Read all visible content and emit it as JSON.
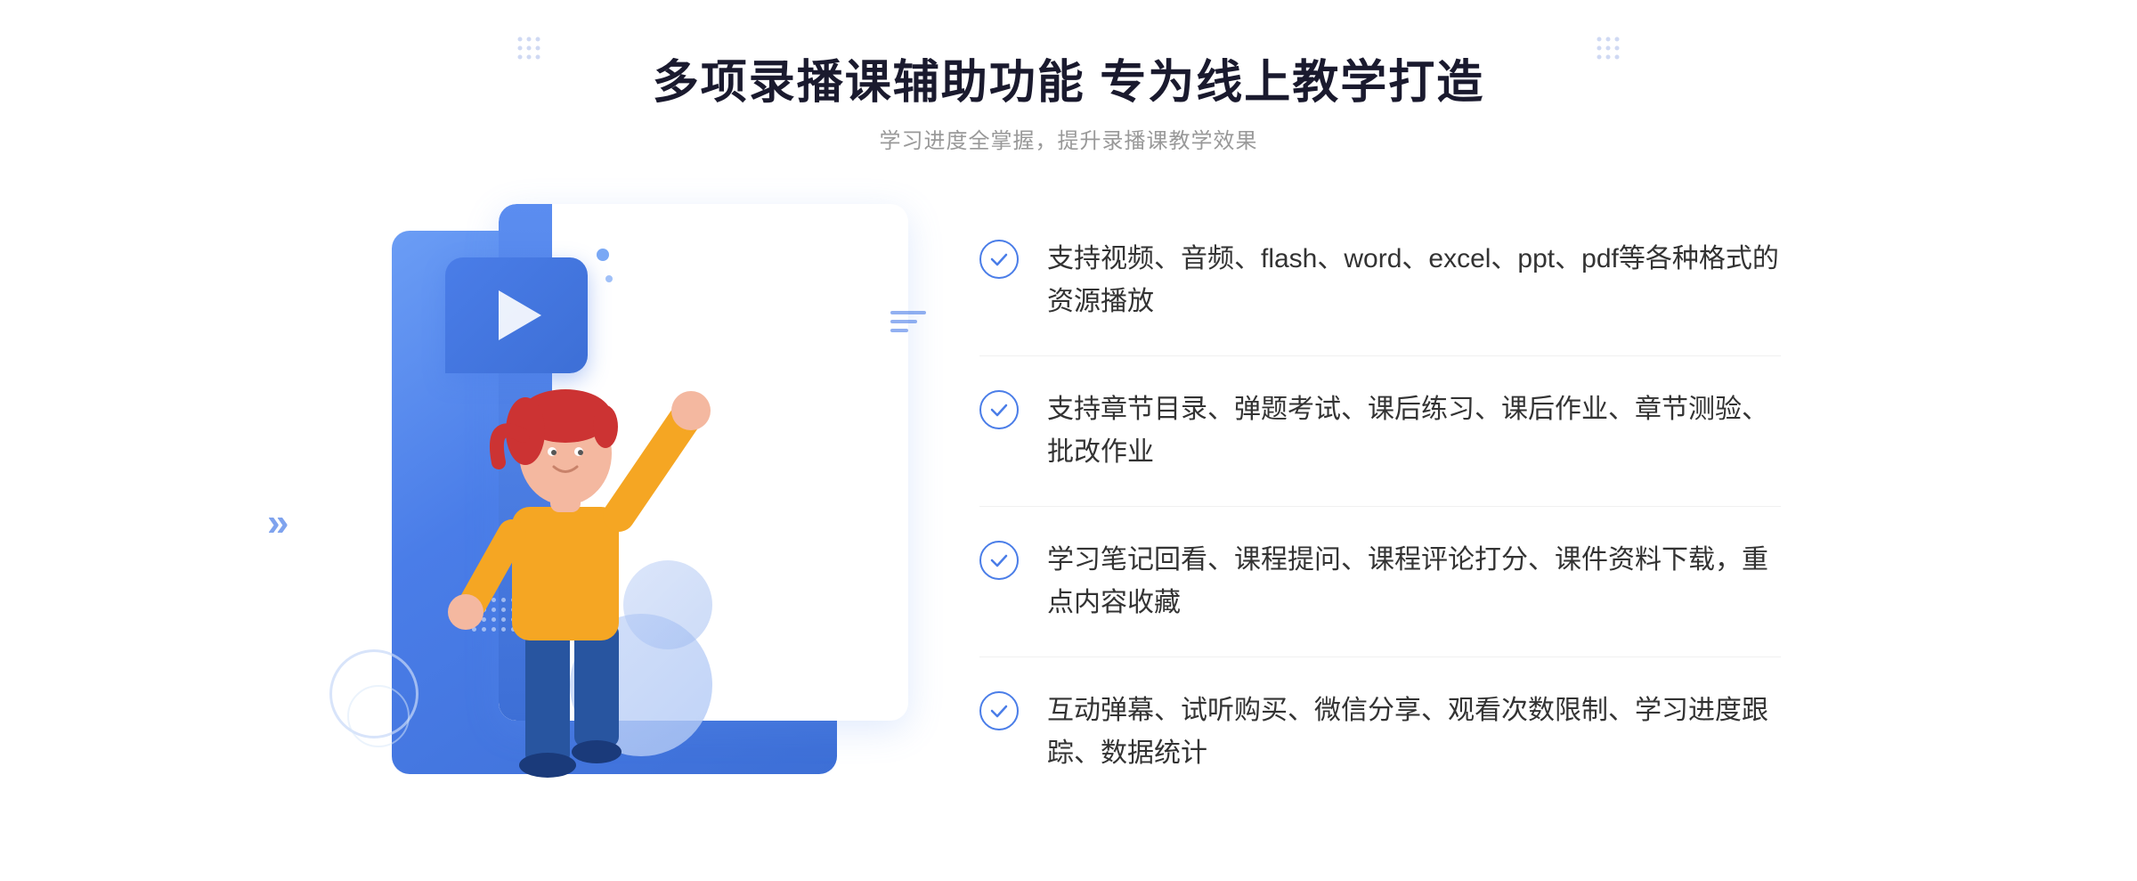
{
  "page": {
    "title": "多项录播课辅助功能 专为线上教学打造",
    "subtitle": "学习进度全掌握，提升录播课教学效果"
  },
  "features": [
    {
      "id": 1,
      "text": "支持视频、音频、flash、word、excel、ppt、pdf等各种格式的资源播放"
    },
    {
      "id": 2,
      "text": "支持章节目录、弹题考试、课后练习、课后作业、章节测验、批改作业"
    },
    {
      "id": 3,
      "text": "学习笔记回看、课程提问、课程评论打分、课件资料下载，重点内容收藏"
    },
    {
      "id": 4,
      "text": "互动弹幕、试听购买、微信分享、观看次数限制、学习进度跟踪、数据统计"
    }
  ],
  "icons": {
    "dots_label": "decorative-dots",
    "play_label": "play-button-icon",
    "check_label": "check-circle-icon",
    "arrows_label": "chevron-right-icon"
  },
  "colors": {
    "primary": "#4a7de8",
    "text_dark": "#1a1a2e",
    "text_gray": "#999999",
    "text_body": "#333333",
    "border": "#f0f0f0",
    "bg": "#ffffff"
  }
}
